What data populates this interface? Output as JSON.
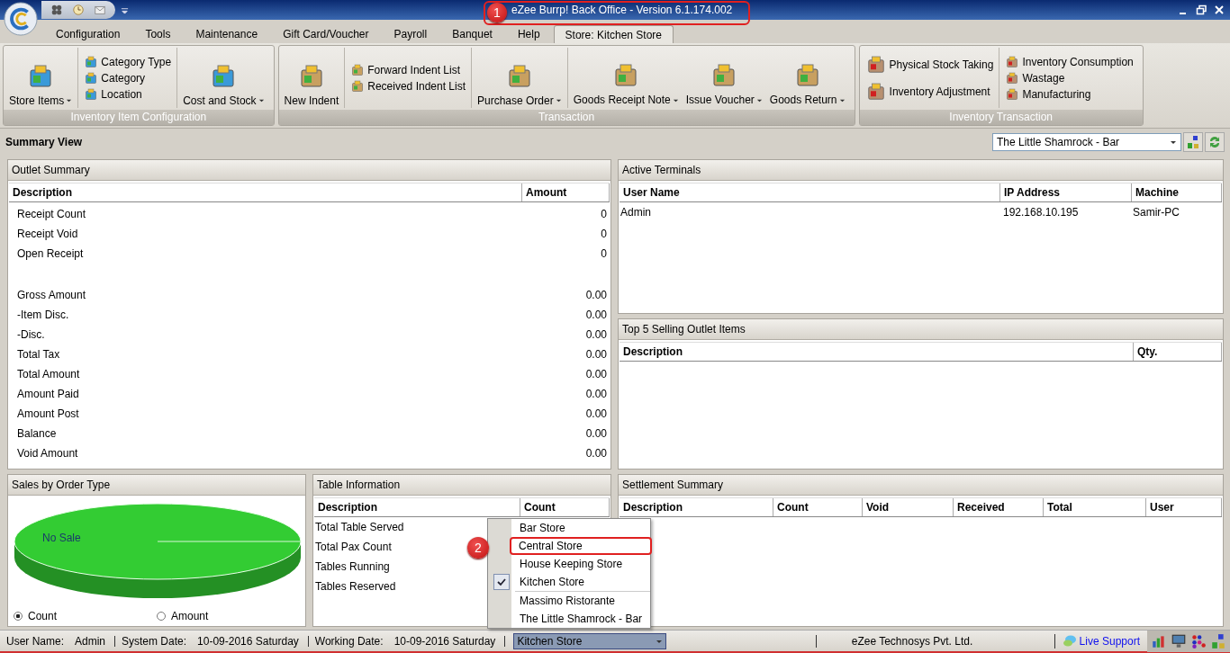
{
  "window": {
    "title": "eZee Burrp! Back Office - Version 6.1.174.002",
    "callout": "1"
  },
  "menu_tabs": [
    {
      "label": "Configuration",
      "selected": false
    },
    {
      "label": "Tools",
      "selected": false
    },
    {
      "label": "Maintenance",
      "selected": false
    },
    {
      "label": "Gift Card/Voucher",
      "selected": false
    },
    {
      "label": "Payroll",
      "selected": false
    },
    {
      "label": "Banquet",
      "selected": false
    },
    {
      "label": "Help",
      "selected": false
    },
    {
      "label": "Store: Kitchen Store",
      "selected": true
    }
  ],
  "ribbon": {
    "groups": [
      {
        "title": "Inventory Item Configuration",
        "columns": [
          [
            {
              "label": "Store Items",
              "kind": "large",
              "dropdown": true
            }
          ],
          [
            {
              "label": "Category Type",
              "kind": "small",
              "dropdown": false
            },
            {
              "label": "Category",
              "kind": "small",
              "dropdown": false
            },
            {
              "label": "Location",
              "kind": "small",
              "dropdown": false
            }
          ],
          [
            {
              "label": "Cost and Stock",
              "kind": "large",
              "dropdown": true
            }
          ]
        ]
      },
      {
        "title": "Transaction",
        "columns": [
          [
            {
              "label": "New Indent",
              "kind": "large",
              "dropdown": false
            }
          ],
          [
            {
              "label": "Forward Indent List",
              "kind": "small",
              "dropdown": false
            },
            {
              "label": "Received Indent List",
              "kind": "small",
              "dropdown": false
            }
          ],
          [
            {
              "label": "Purchase Order",
              "kind": "large",
              "dropdown": true
            }
          ],
          [
            {
              "label": "Goods Receipt Note",
              "kind": "large",
              "dropdown": true
            },
            {
              "label": "Issue Voucher",
              "kind": "large",
              "dropdown": true
            },
            {
              "label": "Goods Return",
              "kind": "large",
              "dropdown": true
            }
          ]
        ]
      },
      {
        "title": "Inventory Transaction",
        "columns": [
          [
            {
              "label": "Physical Stock Taking",
              "kind": "medium",
              "dropdown": false
            },
            {
              "label": "Inventory Adjustment",
              "kind": "medium",
              "dropdown": false
            }
          ],
          [
            {
              "label": "Inventory Consumption",
              "kind": "small",
              "dropdown": false
            },
            {
              "label": "Wastage",
              "kind": "small",
              "dropdown": false
            },
            {
              "label": "Manufacturing",
              "kind": "small",
              "dropdown": false
            }
          ]
        ]
      }
    ]
  },
  "summary": {
    "title": "Summary View",
    "outlet": "The Little Shamrock - Bar"
  },
  "outlet_summary": {
    "title": "Outlet Summary",
    "columns": [
      "Description",
      "Amount"
    ],
    "row_groups": [
      [
        {
          "description": "Receipt Count",
          "amount": "0"
        },
        {
          "description": "Receipt Void",
          "amount": "0"
        },
        {
          "description": "Open Receipt",
          "amount": "0"
        }
      ],
      [
        {
          "description": "Gross Amount",
          "amount": "0.00"
        },
        {
          "description": "-Item Disc.",
          "amount": "0.00"
        },
        {
          "description": "-Disc.",
          "amount": "0.00"
        },
        {
          "description": "Total Tax",
          "amount": "0.00"
        },
        {
          "description": "Total Amount",
          "amount": "0.00"
        },
        {
          "description": "Amount Paid",
          "amount": "0.00"
        },
        {
          "description": "Amount Post",
          "amount": "0.00"
        },
        {
          "description": "Balance",
          "amount": "0.00"
        },
        {
          "description": "Void Amount",
          "amount": "0.00"
        }
      ]
    ]
  },
  "active_terminals": {
    "title": "Active Terminals",
    "columns": [
      "User Name",
      "IP Address",
      "Machine"
    ],
    "rows": [
      [
        "Admin",
        "192.168.10.195",
        "Samir-PC"
      ]
    ]
  },
  "top_selling": {
    "title": "Top 5 Selling Outlet Items",
    "columns": [
      "Description",
      "Qty."
    ]
  },
  "sales_by_order_type": {
    "title": "Sales by Order Type",
    "pie_label": "No Sale",
    "options": [
      {
        "label": "Count",
        "selected": true
      },
      {
        "label": "Amount",
        "selected": false
      }
    ]
  },
  "table_information": {
    "title": "Table Information",
    "columns": [
      "Description",
      "Count"
    ],
    "rows": [
      "Total Table Served",
      "Total Pax Count",
      "Tables Running",
      "Tables Reserved"
    ]
  },
  "settlement_summary": {
    "title": "Settlement Summary",
    "columns": [
      "Description",
      "Count",
      "Void",
      "Received",
      "Total",
      "User"
    ]
  },
  "store_menu": {
    "callout": "2",
    "groups": [
      [
        {
          "label": "Bar Store",
          "checked": false,
          "highlighted": false
        },
        {
          "label": "Central Store",
          "checked": false,
          "highlighted": true
        },
        {
          "label": "House Keeping Store",
          "checked": false,
          "highlighted": false
        },
        {
          "label": "Kitchen Store",
          "checked": true,
          "highlighted": false
        }
      ],
      [
        {
          "label": "Massimo Ristorante",
          "checked": false,
          "highlighted": false
        },
        {
          "label": "The Little Shamrock - Bar",
          "checked": false,
          "highlighted": false
        }
      ]
    ]
  },
  "status_bar": {
    "fields": [
      {
        "label": "User Name:",
        "value": "Admin"
      },
      {
        "label": "System Date:",
        "value": "10-09-2016 Saturday"
      },
      {
        "label": "Working Date:",
        "value": "10-09-2016 Saturday"
      }
    ],
    "store": "Kitchen Store",
    "company": "eZee Technosys Pvt. Ltd.",
    "live_support": "Live Support"
  }
}
